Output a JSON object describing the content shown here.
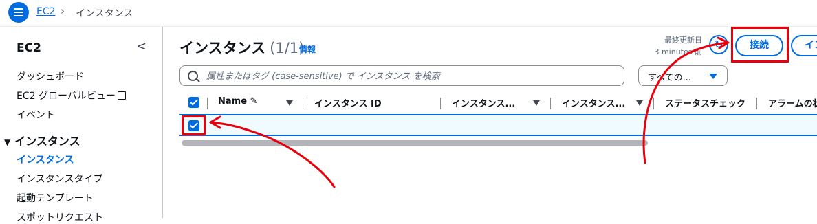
{
  "breadcrumb": {
    "root": "EC2",
    "separator": "›",
    "current": "インスタンス"
  },
  "sidebar": {
    "title": "EC2",
    "links": [
      "ダッシュボード",
      "EC2 グローバルビュー",
      "イベント"
    ],
    "section": "インスタンス",
    "section_items": [
      "インスタンス",
      "インスタンスタイプ",
      "起動テンプレート",
      "スポットリクエスト"
    ]
  },
  "main": {
    "title": "インスタンス",
    "count": "(1/1)",
    "info_link": "情報",
    "last_updated_label": "最終更新日",
    "last_updated_value": "3 minutes 前",
    "connect_label": "接続",
    "more_label": "イン",
    "search_placeholder": "属性またはタグ (case-sensitive) で インスタンス を検索",
    "filter_value": "すべての..."
  },
  "table": {
    "columns": [
      "Name",
      "インスタンス ID",
      "インスタンス...",
      "インスタンス...",
      "ステータスチェック",
      "アラームの状"
    ],
    "rows": [
      {
        "selected": true
      }
    ]
  },
  "annotations": {
    "color": "#e8000b"
  },
  "colors": {
    "accent": "#006ce0",
    "text": "#0f141a",
    "muted": "#5f6b7a"
  }
}
